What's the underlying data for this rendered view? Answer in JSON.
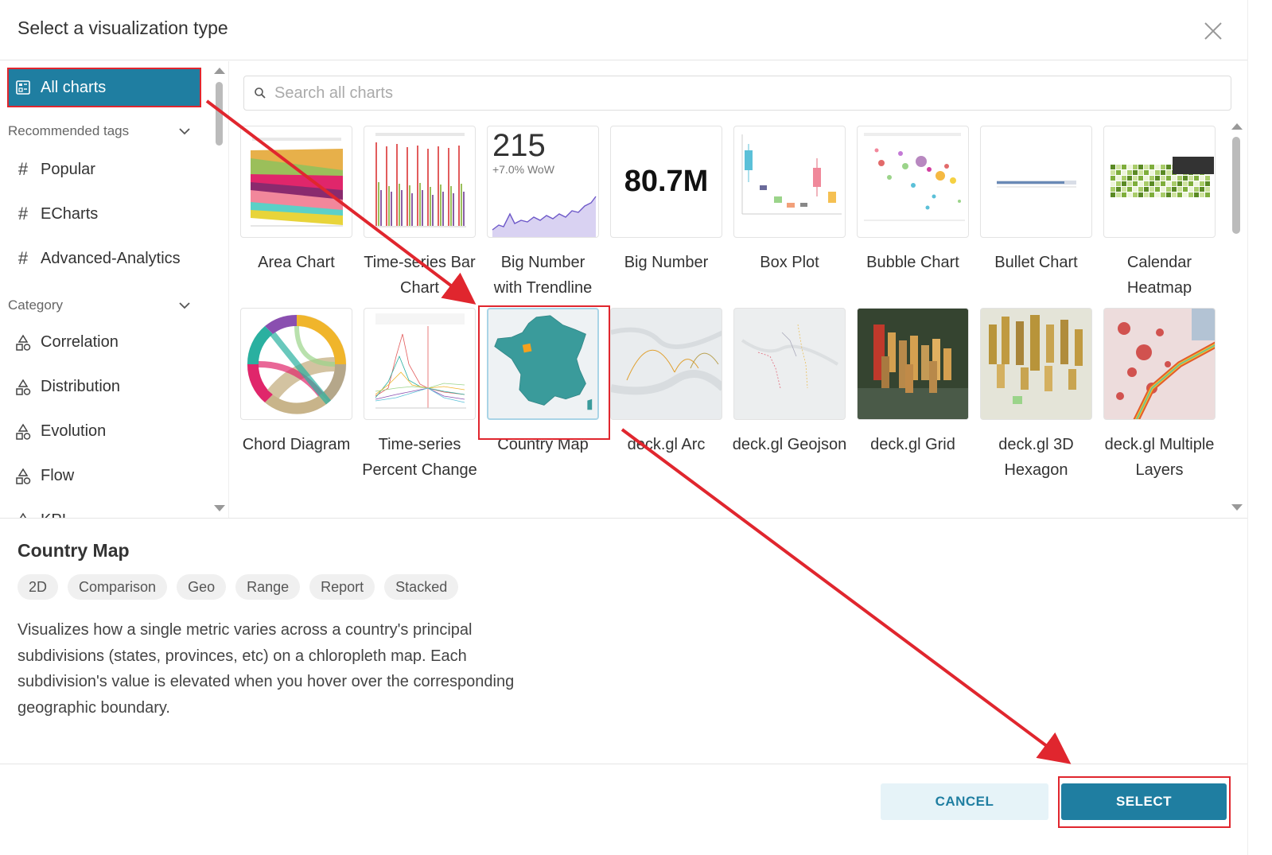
{
  "dialog": {
    "title": "Select a visualization type"
  },
  "sidebar": {
    "all_charts_label": "All charts",
    "recommended_tags_header": "Recommended tags",
    "tags": [
      {
        "label": "Popular"
      },
      {
        "label": "ECharts"
      },
      {
        "label": "Advanced-Analytics"
      }
    ],
    "category_header": "Category",
    "categories": [
      {
        "label": "Correlation"
      },
      {
        "label": "Distribution"
      },
      {
        "label": "Evolution"
      },
      {
        "label": "Flow"
      },
      {
        "label": "KPI"
      }
    ]
  },
  "search": {
    "placeholder": "Search all charts"
  },
  "charts_row1": [
    {
      "label": "Area Chart"
    },
    {
      "label": "Time-series Bar Chart"
    },
    {
      "label": "Big Number with Trendline",
      "thumb_number": "215",
      "thumb_sub": "+7.0% WoW"
    },
    {
      "label": "Big Number",
      "thumb_number": "80.7M"
    },
    {
      "label": "Box Plot"
    },
    {
      "label": "Bubble Chart"
    },
    {
      "label": "Bullet Chart"
    },
    {
      "label": "Calendar Heatmap"
    }
  ],
  "charts_row2": [
    {
      "label": "Chord Diagram"
    },
    {
      "label": "Time-series Percent Change"
    },
    {
      "label": "Country Map"
    },
    {
      "label": "deck.gl Arc"
    },
    {
      "label": "deck.gl Geojson"
    },
    {
      "label": "deck.gl Grid"
    },
    {
      "label": "deck.gl 3D Hexagon"
    },
    {
      "label": "deck.gl Multiple Layers"
    }
  ],
  "detail": {
    "title": "Country Map",
    "tags": [
      "2D",
      "Comparison",
      "Geo",
      "Range",
      "Report",
      "Stacked"
    ],
    "description": "Visualizes how a single metric varies across a country's principal subdivisions (states, provinces, etc) on a chloropleth map. Each subdivision's value is elevated when you hover over the corresponding geographic boundary."
  },
  "footer": {
    "cancel_label": "CANCEL",
    "select_label": "SELECT"
  },
  "colors": {
    "accent": "#1f7ea1",
    "annotation": "#e0262e",
    "map_teal": "#3a9b9b"
  }
}
